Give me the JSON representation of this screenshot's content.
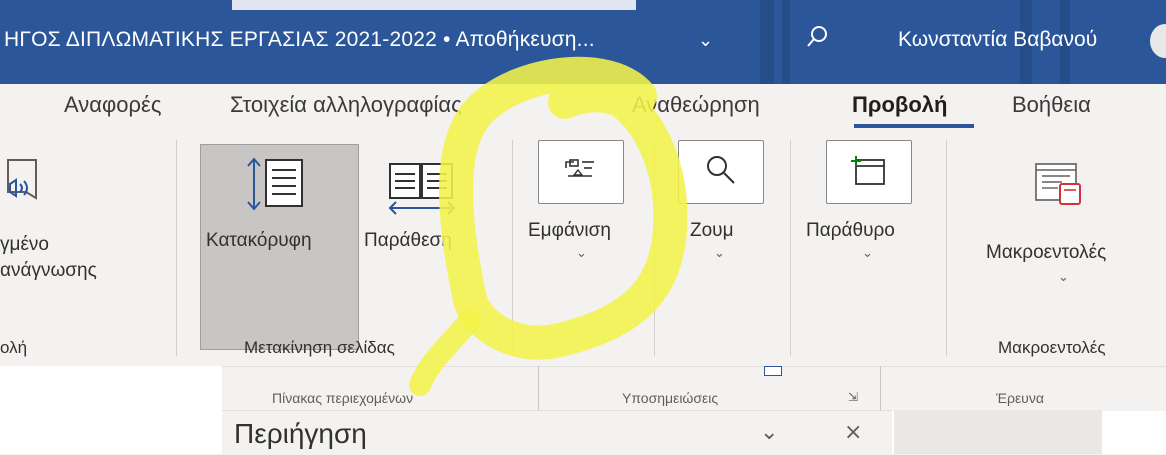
{
  "titlebar": {
    "document_title": "ΗΓΟΣ ΔΙΠΛΩΜΑΤΙΚΗΣ ΕΡΓΑΣΙΑΣ 2021-2022 • Αποθήκευση...",
    "chevron": "⌄",
    "user_name": "Κωνσταντία Βαβανού"
  },
  "tabs": [
    {
      "label": "Αναφορές"
    },
    {
      "label": "Στοιχεία αλληλογραφίας"
    },
    {
      "label": "Αναθεώρηση"
    },
    {
      "label": "Προβολή",
      "active": true
    },
    {
      "label": "Βοήθεια"
    }
  ],
  "ribbon": {
    "immersive": {
      "line1": "γμένο",
      "line2": "ανάγνωσης",
      "group": "ολή"
    },
    "vertical": {
      "label": "Κατακόρυφη"
    },
    "side_by_side": {
      "label": "Παράθεση"
    },
    "page_movement_group": "Μετακίνηση σελίδας",
    "show": {
      "label": "Εμφάνιση"
    },
    "zoom": {
      "label": "Ζουμ"
    },
    "window": {
      "label": "Παράθυρο"
    },
    "macros": {
      "label": "Μακροεντολές",
      "group": "Μακροεντολές"
    }
  },
  "subribbon": {
    "toc_group": "Πίνακας περιεχομένων",
    "footnotes_group": "Υποσημειώσεις",
    "research_group": "Έρευνα"
  },
  "navpane": {
    "title": "Περιήγηση",
    "options": "⌄",
    "close": "×"
  },
  "colors": {
    "titlebar": "#2b579a",
    "highlight": "#f2f24a",
    "ribbon_bg": "#f3f2f1"
  }
}
